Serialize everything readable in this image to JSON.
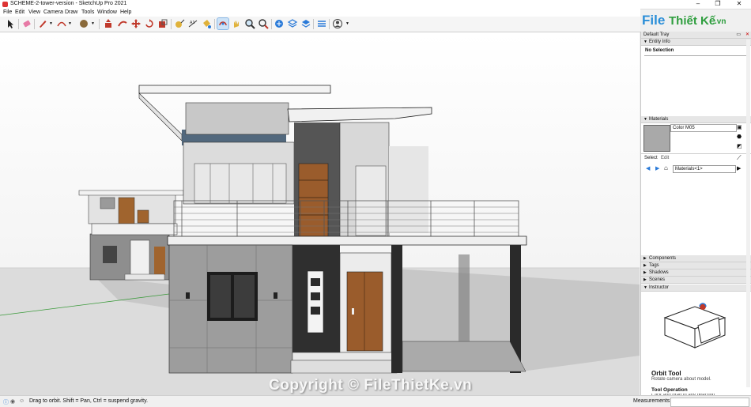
{
  "window": {
    "title": "SCHEME-2-tower-version - SketchUp Pro 2021",
    "minimize": "–",
    "maximize": "❐",
    "close": "✕"
  },
  "menu": [
    "File",
    "Edit",
    "View",
    "Camera",
    "Draw",
    "Tools",
    "Window",
    "Help"
  ],
  "brand": {
    "file": "File",
    "rest": "Thiết Kế",
    "tld": ".vn"
  },
  "tray": {
    "title": "Default Tray",
    "entity_info": {
      "label": "Entity Info",
      "selection": "No Selection"
    },
    "materials": {
      "label": "Materials",
      "name": "Color M05",
      "select_tab": "Select",
      "edit_tab": "Edit",
      "library": "Materials<1>"
    },
    "sections": [
      "Components",
      "Tags",
      "Shadows",
      "Scenes",
      "Instructor"
    ],
    "instructor": {
      "tool": "Orbit Tool",
      "desc": "Rotate camera about model.",
      "operation": "Tool Operation",
      "op_text": "Click and drag in any direction."
    }
  },
  "watermark": "Copyright © FileThietKe.vn",
  "status": {
    "hint": "Drag to orbit. Shift = Pan, Ctrl = suspend gravity.",
    "measurements_label": "Measurements"
  },
  "colors": {
    "accent": "#2a8ed8",
    "brand_green": "#2e9e3e",
    "selection": "#cde3f7"
  }
}
